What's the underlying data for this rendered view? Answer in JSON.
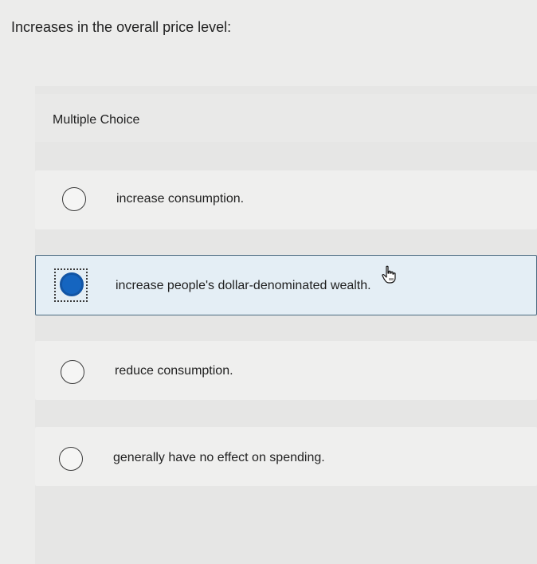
{
  "question": {
    "text": "Increases in the overall price level:"
  },
  "multiple_choice": {
    "header": "Multiple Choice",
    "options": [
      {
        "label": "increase consumption.",
        "selected": false
      },
      {
        "label": "increase people's dollar-denominated wealth.",
        "selected": true
      },
      {
        "label": "reduce consumption.",
        "selected": false
      },
      {
        "label": "generally have no effect on spending.",
        "selected": false
      }
    ]
  },
  "colors": {
    "selected_radio": "#1565c0",
    "selected_border": "#4b6a80",
    "selected_background": "#e4eef5"
  },
  "icons": {
    "cursor": "hand-pointer-icon"
  }
}
